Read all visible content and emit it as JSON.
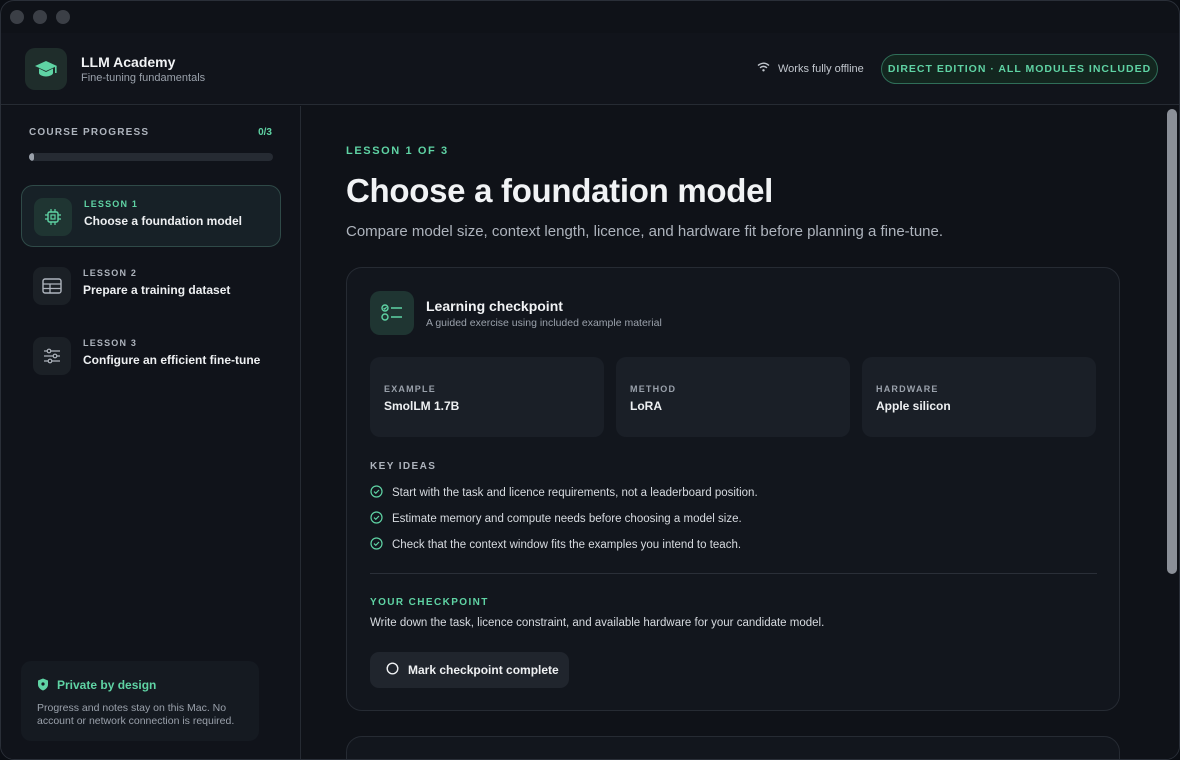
{
  "app": {
    "title": "LLM Academy",
    "subtitle": "Fine-tuning fundamentals",
    "offline_text": "Works fully offline",
    "edition_badge": "DIRECT EDITION · ALL MODULES INCLUDED"
  },
  "sidebar": {
    "progress_label": "COURSE PROGRESS",
    "progress_count": "0/3",
    "progress_fraction": 0.02,
    "lessons": [
      {
        "number": "LESSON 1",
        "title": "Choose a foundation model",
        "icon": "chip-icon",
        "active": true
      },
      {
        "number": "LESSON 2",
        "title": "Prepare a training dataset",
        "icon": "table-icon",
        "active": false
      },
      {
        "number": "LESSON 3",
        "title": "Configure an efficient fine-tune",
        "icon": "sliders-icon",
        "active": false
      }
    ],
    "privacy": {
      "title": "Private by design",
      "body": "Progress and notes stay on this Mac. No account or network connection is required."
    }
  },
  "main": {
    "eyebrow": "LESSON 1 OF 3",
    "title": "Choose a foundation model",
    "description": "Compare model size, context length, licence, and hardware fit before planning a fine-tune.",
    "checkpoint": {
      "title": "Learning checkpoint",
      "subtitle": "A guided exercise using included example material",
      "meta": [
        {
          "label": "EXAMPLE",
          "value": "SmolLM 1.7B"
        },
        {
          "label": "METHOD",
          "value": "LoRA"
        },
        {
          "label": "HARDWARE",
          "value": "Apple silicon"
        }
      ],
      "key_ideas_label": "KEY IDEAS",
      "key_ideas": [
        "Start with the task and licence requirements, not a leaderboard position.",
        "Estimate memory and compute needs before choosing a model size.",
        "Check that the context window fits the examples you intend to teach."
      ],
      "your_label": "YOUR CHECKPOINT",
      "your_text": "Write down the task, licence constraint, and available hardware for your candidate model.",
      "button_label": "Mark checkpoint complete"
    }
  },
  "colors": {
    "accent": "#5fd3a4",
    "background": "#0f1218"
  }
}
